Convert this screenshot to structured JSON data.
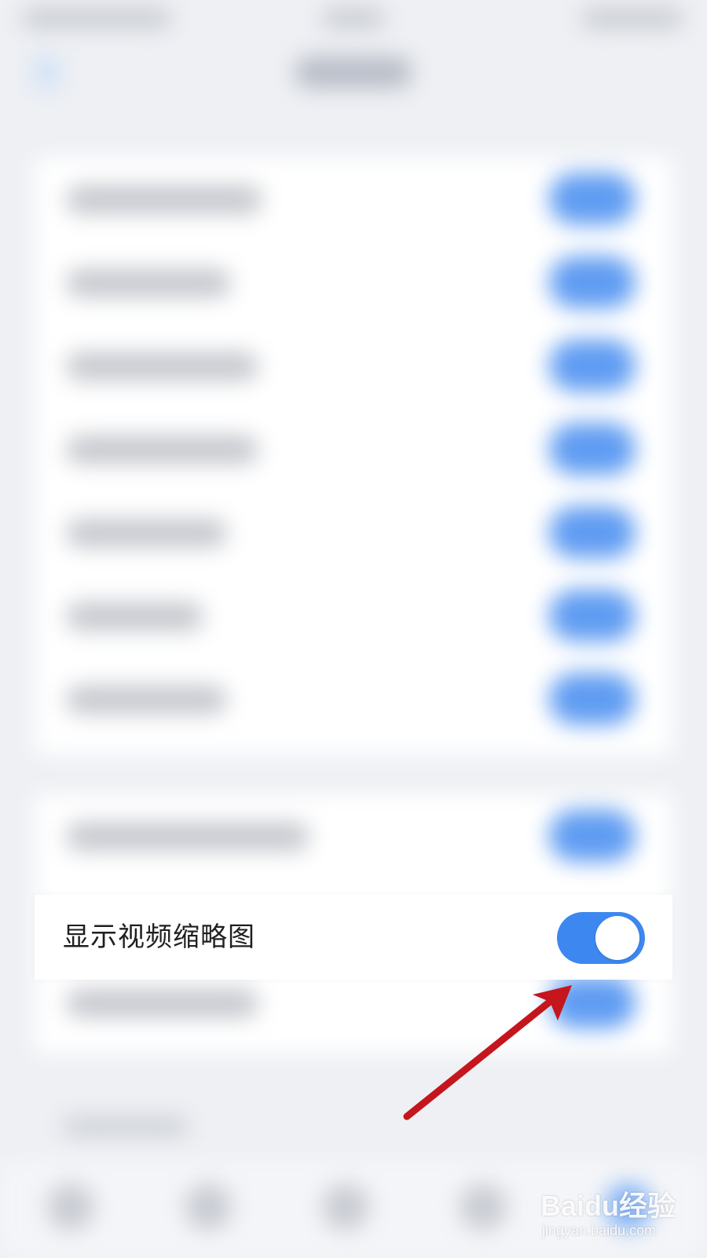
{
  "settings_row": {
    "label": "显示视频缩略图",
    "toggle_state": "on",
    "toggle_color": "#3d87f0"
  },
  "annotation": {
    "arrow_color": "#c4161c",
    "points_to": "toggle"
  },
  "watermark": {
    "brand": "Baidu经验",
    "url": "jingyan.baidu.com"
  },
  "colors": {
    "background": "#eef0f4",
    "card": "#ffffff",
    "accent": "#3d87f0"
  }
}
